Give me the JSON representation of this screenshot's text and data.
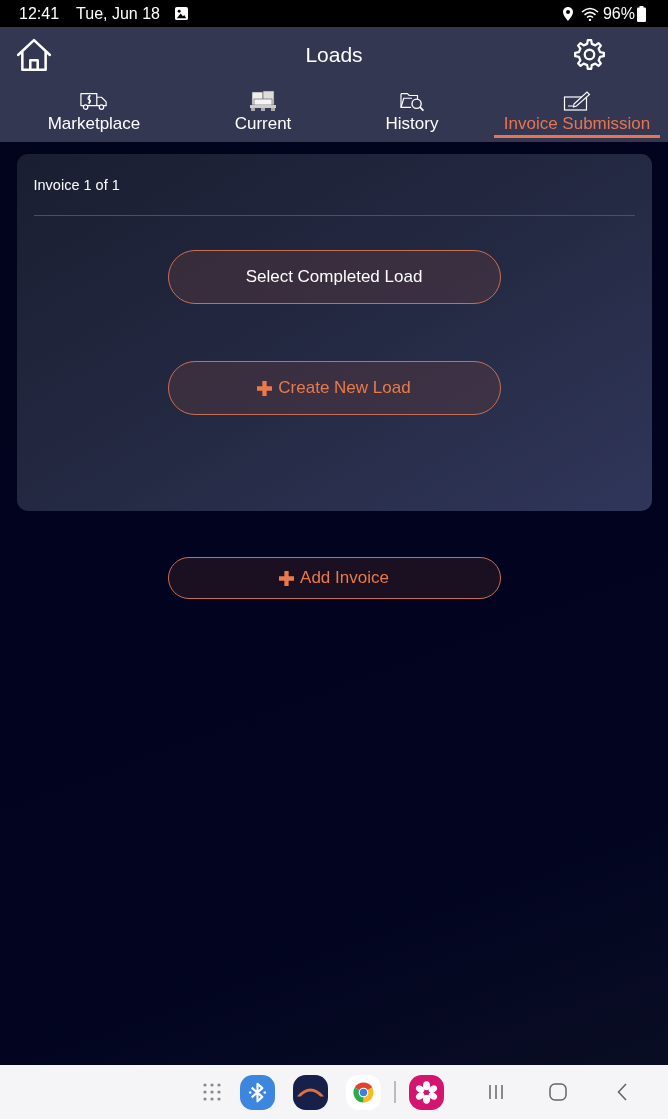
{
  "status_bar": {
    "time": "12:41",
    "date": "Tue, Jun 18",
    "battery": "96%"
  },
  "header": {
    "title": "Loads"
  },
  "tabs": [
    {
      "label": "Marketplace",
      "kind": "truck",
      "selected": false
    },
    {
      "label": "Current",
      "kind": "boxes",
      "selected": false
    },
    {
      "label": "History",
      "kind": "folder-search",
      "selected": false
    },
    {
      "label": "Invoice Submission",
      "kind": "check-pen",
      "selected": true
    }
  ],
  "invoice_card": {
    "counter": "Invoice 1 of 1",
    "actions": [
      {
        "label": "Select Completed Load",
        "kind": "plain"
      },
      {
        "label": "Create New Load",
        "kind": "add"
      }
    ]
  },
  "add_invoice": {
    "label": "Add Invoice"
  }
}
